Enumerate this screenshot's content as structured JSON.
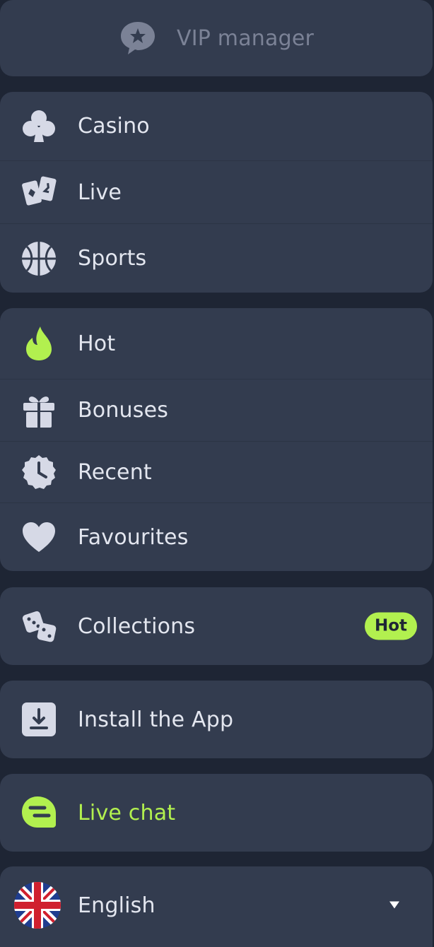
{
  "vip": {
    "label": "VIP manager",
    "icon": "star-chat-icon"
  },
  "nav_primary": [
    {
      "label": "Casino",
      "icon": "club-icon"
    },
    {
      "label": "Live",
      "icon": "cards-icon"
    },
    {
      "label": "Sports",
      "icon": "basketball-icon"
    }
  ],
  "nav_secondary": [
    {
      "label": "Hot",
      "icon": "flame-icon"
    },
    {
      "label": "Bonuses",
      "icon": "gift-icon"
    },
    {
      "label": "Recent",
      "icon": "clock-icon"
    },
    {
      "label": "Favourites",
      "icon": "heart-icon"
    }
  ],
  "collections": {
    "label": "Collections",
    "badge": "Hot",
    "icon": "dice-icon"
  },
  "install": {
    "label": "Install the App",
    "icon": "download-icon"
  },
  "chat": {
    "label": "Live chat",
    "icon": "chat-icon"
  },
  "language": {
    "label": "English",
    "icon": "uk-flag-icon"
  },
  "colors": {
    "background": "#1e2534",
    "card": "#333c4f",
    "text": "#e3e6ef",
    "muted": "#7b8296",
    "accent": "#b2f04f",
    "icon": "#d6d9e6"
  }
}
